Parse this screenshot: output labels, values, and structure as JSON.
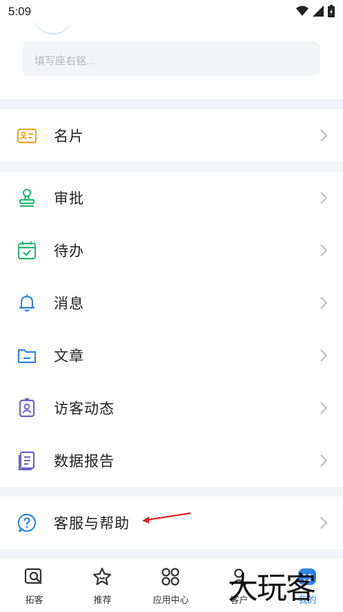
{
  "status_bar": {
    "time": "5:09"
  },
  "profile": {
    "motto_placeholder": "填写座右铭..."
  },
  "groups": [
    {
      "items": [
        {
          "label": "名片",
          "icon": "business-card-icon"
        }
      ]
    },
    {
      "items": [
        {
          "label": "审批",
          "icon": "stamp-icon"
        },
        {
          "label": "待办",
          "icon": "calendar-check-icon"
        },
        {
          "label": "消息",
          "icon": "bell-icon"
        },
        {
          "label": "文章",
          "icon": "folder-icon"
        },
        {
          "label": "访客动态",
          "icon": "visitor-badge-icon"
        },
        {
          "label": "数据报告",
          "icon": "report-icon"
        }
      ]
    },
    {
      "items": [
        {
          "label": "客服与帮助",
          "icon": "help-chat-icon"
        }
      ]
    }
  ],
  "bottom_nav": [
    {
      "label": "拓客",
      "icon": "search-card-icon"
    },
    {
      "label": "推荐",
      "icon": "star-icon"
    },
    {
      "label": "应用中心",
      "icon": "apps-grid-icon"
    },
    {
      "label": "客户",
      "icon": "customer-icon"
    },
    {
      "label": "我的",
      "icon": "profile-icon",
      "active": true
    }
  ],
  "watermark": "大玩客",
  "colors": {
    "accent_blue": "#2f86e9",
    "orange": "#f5a623",
    "green": "#2bb673",
    "purple": "#6c63c9"
  }
}
